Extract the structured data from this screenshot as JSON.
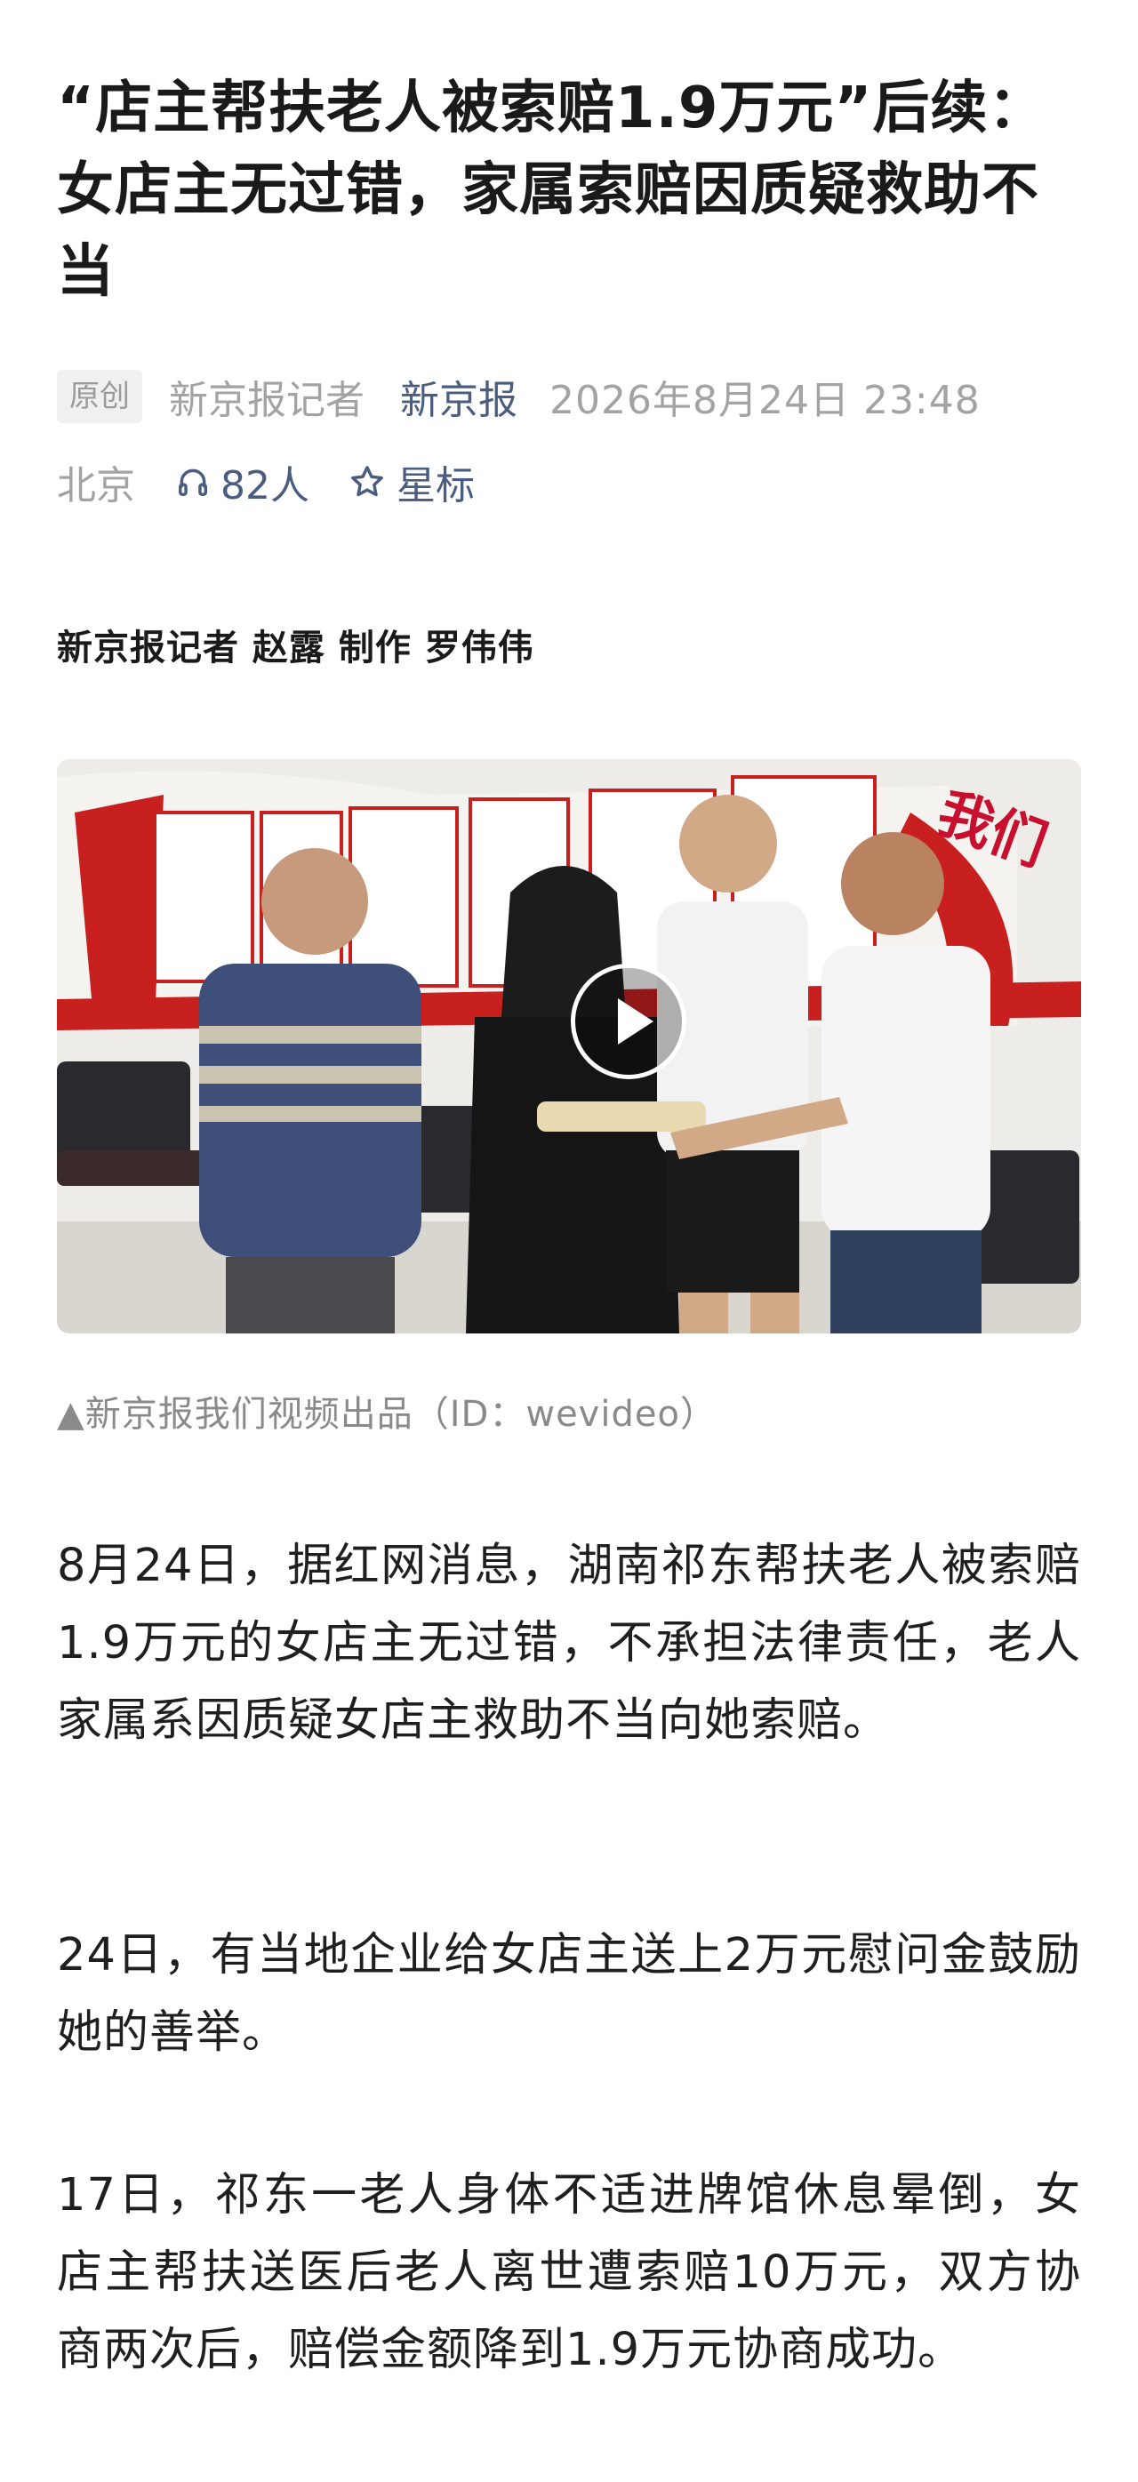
{
  "article": {
    "title": "“店主帮扶老人被索赔1.9万元”后续：女店主无过错，家属索赔因质疑救助不当",
    "meta": {
      "badge": "原创",
      "reporter_label": "新京报记者",
      "source": "新京报",
      "datetime": "2026年8月24日 23:48",
      "location": "北京",
      "listen_count": "82人",
      "star_label": "星标",
      "listen_icon": "headphones-icon",
      "star_icon": "star-outline-icon"
    },
    "byline": "新京报记者 赵露 制作 罗伟伟",
    "video": {
      "caption": "▲新京报我们视频出品（ID：wevideo）",
      "watermark": "我们",
      "play_icon": "play-icon"
    },
    "paragraphs": [
      "8月24日，据红网消息，湖南祁东帮扶老人被索赔1.9万元的女店主无过错，不承担法律责任，老人家属系因质疑女店主救助不当向她索赔。",
      "24日，有当地企业给女店主送上2万元慰问金鼓励她的善举。",
      "17日，祁东一老人身体不适进牌馆休息晕倒，女店主帮扶送医后老人离世遭索赔10万元，双方协商两次后，赔偿金额降到1.9万元协商成功。"
    ]
  },
  "colors": {
    "meta_link": "#4a5d7e",
    "meta_gray": "#a3a3a3",
    "text": "#1f1f1f",
    "caption": "#8a8a8a",
    "watermark_red": "#c8102e"
  }
}
